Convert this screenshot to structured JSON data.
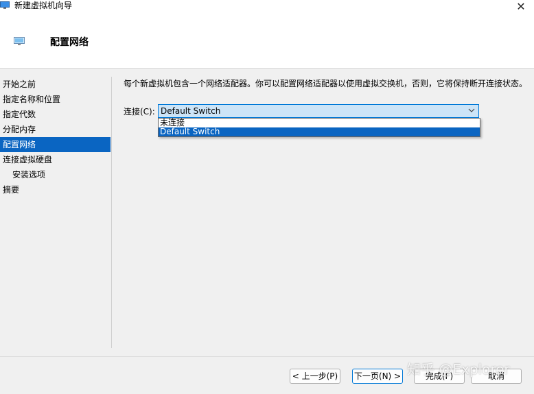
{
  "window": {
    "title": "新建虚拟机向导",
    "close_glyph": "✕"
  },
  "header": {
    "title": "配置网络"
  },
  "nav": {
    "items": [
      {
        "label": "开始之前"
      },
      {
        "label": "指定名称和位置"
      },
      {
        "label": "指定代数"
      },
      {
        "label": "分配内存"
      },
      {
        "label": "配置网络",
        "active": true
      },
      {
        "label": "连接虚拟硬盘"
      },
      {
        "label": "安装选项",
        "sub": true
      },
      {
        "label": "摘要"
      }
    ]
  },
  "content": {
    "description": "每个新虚拟机包含一个网络适配器。你可以配置网络适配器以使用虚拟交换机，否则，它将保持断开连接状态。",
    "connection_label": "连接(C):",
    "connection_value": "Default Switch",
    "dropdown_options": [
      "未连接",
      "Default Switch"
    ],
    "dropdown_selected": "Default Switch"
  },
  "footer": {
    "back_label": "< 上一步(P)",
    "next_label": "下一页(N) >",
    "finish_label": "完成(F)",
    "cancel_label": "取消"
  },
  "watermark": "知乎 @Explorer",
  "colors": {
    "selection": "#0a65c2",
    "select_bg": "#cce4f7",
    "focus_border": "#0078d7",
    "window_bg": "#f0f0f0"
  },
  "icons": {
    "app": "monitor-icon",
    "header": "monitor-icon",
    "chevron": "chevron-down-icon",
    "close": "close-icon"
  }
}
